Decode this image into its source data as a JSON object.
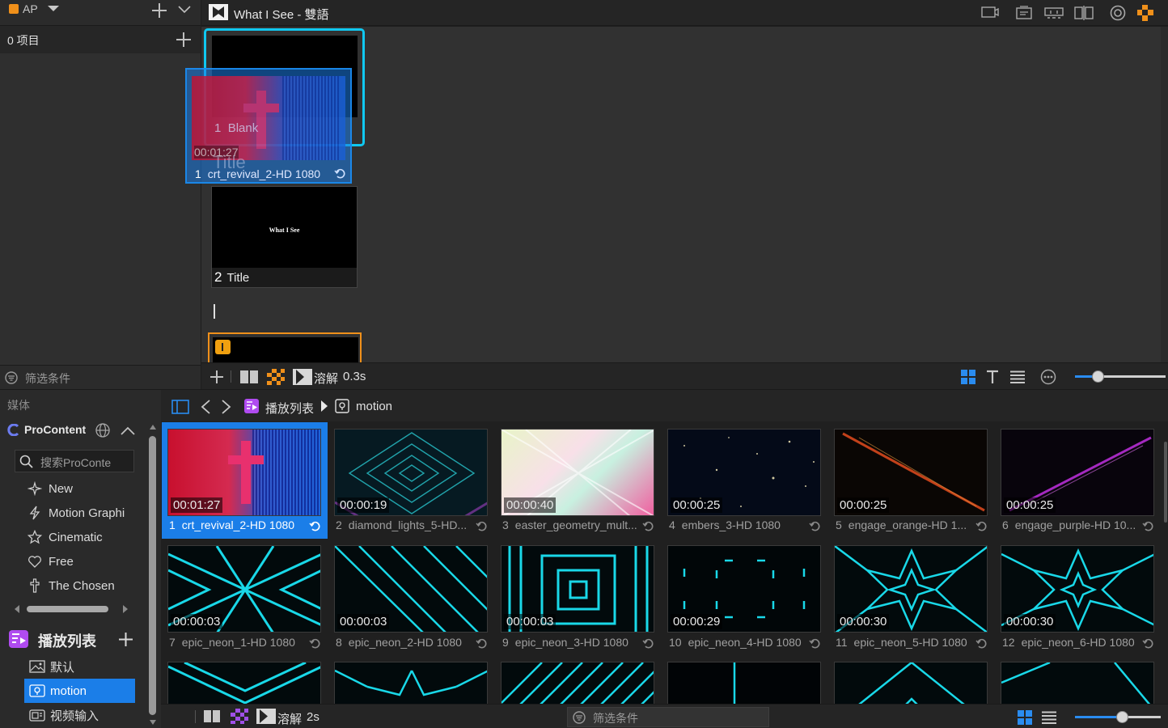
{
  "library": {
    "app_badge": "AP",
    "items_count": "0 项目",
    "filter_label": "筛选条件"
  },
  "presentation": {
    "title": "What I See - 雙語",
    "slides": [
      {
        "num": "1",
        "label": "Blank",
        "ghost_time": "00:01:27",
        "ghost_text": "Title"
      },
      {
        "num": "2",
        "label": "Title",
        "preview_text": "What I See"
      }
    ],
    "drag_item": {
      "num": "1",
      "label": "crt_revival_2-HD 1080"
    },
    "transition_label": "溶解",
    "transition_time": "0.3s",
    "slider_value": 0.25
  },
  "media_panel": {
    "section_label": "媒体",
    "procontent_label": "ProContent",
    "search_placeholder": "搜索ProConte",
    "categories": [
      "New",
      "Motion Graphi",
      "Cinematic",
      "Free",
      "The Chosen"
    ],
    "playlist_header": "播放列表",
    "playlists": [
      "默认",
      "motion",
      "视频输入"
    ],
    "selected_playlist": "motion"
  },
  "media_browser": {
    "breadcrumb_root": "播放列表",
    "breadcrumb_current": "motion",
    "items": [
      {
        "num": "1",
        "name": "crt_revival_2-HD 1080",
        "time": "00:01:27",
        "selected": true
      },
      {
        "num": "2",
        "name": "diamond_lights_5-HD...",
        "time": "00:00:19"
      },
      {
        "num": "3",
        "name": "easter_geometry_mult...",
        "time": "00:00:40"
      },
      {
        "num": "4",
        "name": "embers_3-HD 1080",
        "time": "00:00:25"
      },
      {
        "num": "5",
        "name": "engage_orange-HD 1...",
        "time": "00:00:25"
      },
      {
        "num": "6",
        "name": "engage_purple-HD 10...",
        "time": "00:00:25"
      },
      {
        "num": "7",
        "name": "epic_neon_1-HD 1080",
        "time": "00:00:03"
      },
      {
        "num": "8",
        "name": "epic_neon_2-HD 1080",
        "time": "00:00:03"
      },
      {
        "num": "9",
        "name": "epic_neon_3-HD 1080",
        "time": "00:00:03"
      },
      {
        "num": "10",
        "name": "epic_neon_4-HD 1080",
        "time": "00:00:29"
      },
      {
        "num": "11",
        "name": "epic_neon_5-HD 1080",
        "time": "00:00:30"
      },
      {
        "num": "12",
        "name": "epic_neon_6-HD 1080",
        "time": "00:00:30"
      }
    ],
    "transition_label": "溶解",
    "transition_time": "2s",
    "filter_label": "筛选条件",
    "slider_value": 0.55
  },
  "colors": {
    "accent_blue": "#1b7ee8",
    "cyan_highlight": "#10c8f0",
    "orange": "#f0901a",
    "neon": "#19d8e8"
  }
}
